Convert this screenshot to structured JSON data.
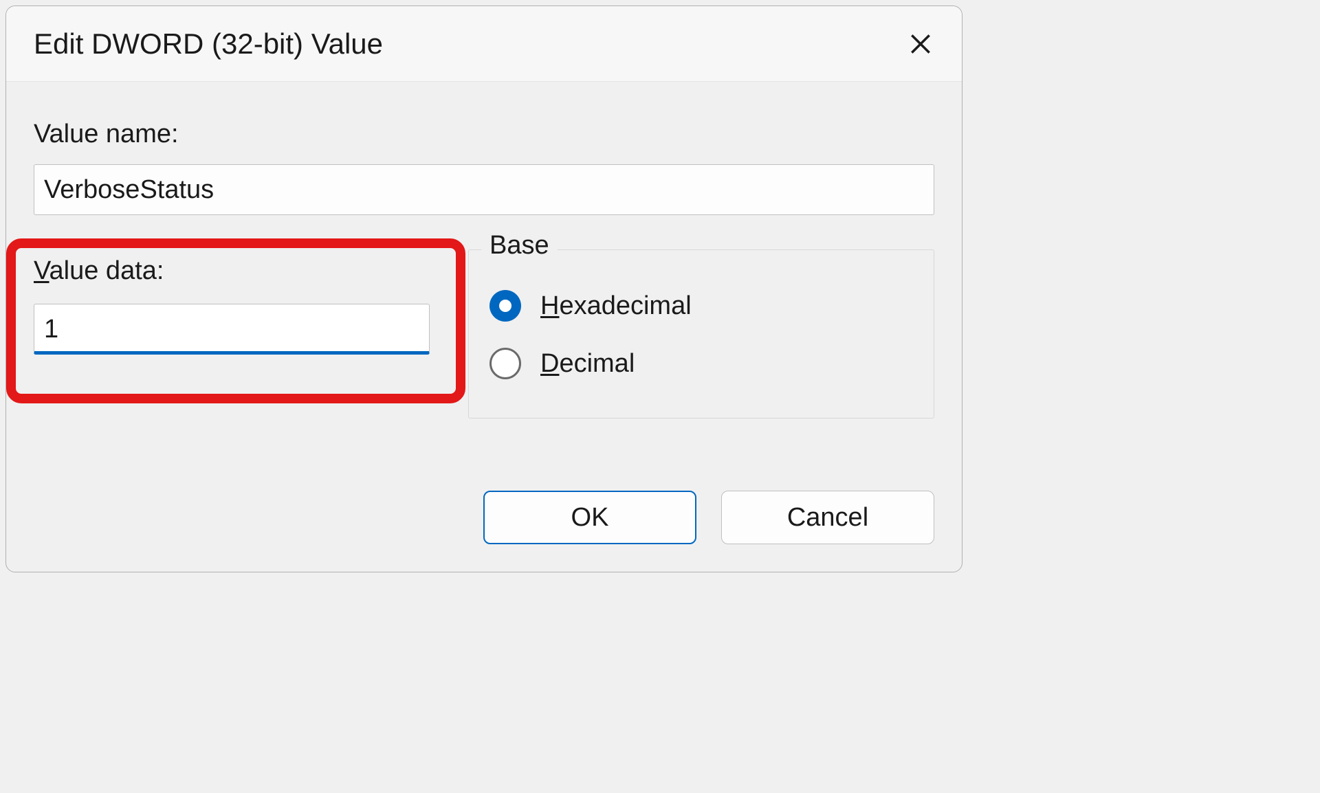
{
  "dialog": {
    "title": "Edit DWORD (32-bit) Value",
    "value_name_label": "Value name:",
    "value_name": "VerboseStatus",
    "value_data_label_prefix": "V",
    "value_data_label_rest": "alue data:",
    "value_data": "1",
    "base": {
      "legend": "Base",
      "hex_prefix": "H",
      "hex_rest": "exadecimal",
      "dec_prefix": "D",
      "dec_rest": "ecimal",
      "selected": "hex"
    },
    "buttons": {
      "ok": "OK",
      "cancel": "Cancel"
    }
  }
}
